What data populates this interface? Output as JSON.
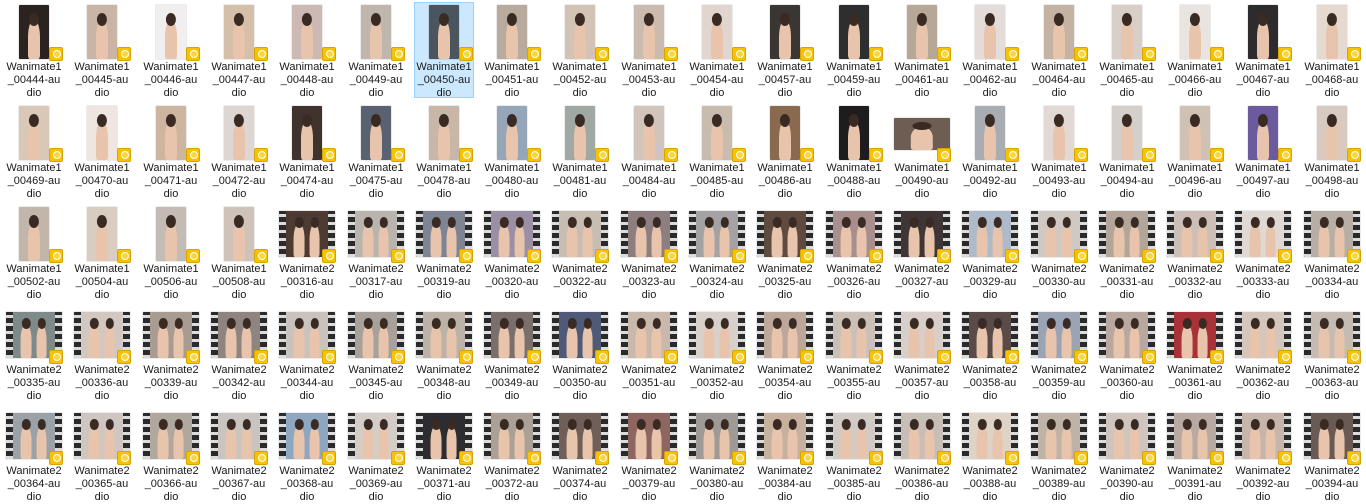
{
  "files": [
    {
      "name": "Wanimate1_00444-audio",
      "kind": "portrait",
      "bg": "#2b2320"
    },
    {
      "name": "Wanimate1_00445-audio",
      "kind": "portrait",
      "bg": "#c9b4a6"
    },
    {
      "name": "Wanimate1_00446-audio",
      "kind": "portrait",
      "bg": "#f0eeee"
    },
    {
      "name": "Wanimate1_00447-audio",
      "kind": "portrait",
      "bg": "#d6bfa8"
    },
    {
      "name": "Wanimate1_00448-audio",
      "kind": "portrait",
      "bg": "#cdb9b3"
    },
    {
      "name": "Wanimate1_00449-audio",
      "kind": "portrait",
      "bg": "#bfb6ad"
    },
    {
      "name": "Wanimate1_00450-audio",
      "kind": "portrait",
      "bg": "#4a5560",
      "selected": true
    },
    {
      "name": "Wanimate1_00451-audio",
      "kind": "portrait",
      "bg": "#b8aa9c"
    },
    {
      "name": "Wanimate1_00452-audio",
      "kind": "portrait",
      "bg": "#d2c3b4"
    },
    {
      "name": "Wanimate1_00453-audio",
      "kind": "portrait",
      "bg": "#cbbbae"
    },
    {
      "name": "Wanimate1_00454-audio",
      "kind": "portrait",
      "bg": "#e1d6cf"
    },
    {
      "name": "Wanimate1_00457-audio",
      "kind": "portrait",
      "bg": "#3a3634"
    },
    {
      "name": "Wanimate1_00459-audio",
      "kind": "portrait",
      "bg": "#2c2e30"
    },
    {
      "name": "Wanimate1_00461-audio",
      "kind": "portrait",
      "bg": "#b7a796"
    },
    {
      "name": "Wanimate1_00462-audio",
      "kind": "portrait",
      "bg": "#e4dcd9"
    },
    {
      "name": "Wanimate1_00464-audio",
      "kind": "portrait",
      "bg": "#c4b3a2"
    },
    {
      "name": "Wanimate1_00465-audio",
      "kind": "portrait",
      "bg": "#d8cfc8"
    },
    {
      "name": "Wanimate1_00466-audio",
      "kind": "portrait",
      "bg": "#e9e4df"
    },
    {
      "name": "Wanimate1_00467-audio",
      "kind": "portrait",
      "bg": "#2d2b2e"
    },
    {
      "name": "Wanimate1_00468-audio",
      "kind": "portrait",
      "bg": "#e6dad0"
    },
    {
      "name": "Wanimate1_00469-audio",
      "kind": "portrait",
      "bg": "#d9c7b8"
    },
    {
      "name": "Wanimate1_00470-audio",
      "kind": "portrait",
      "bg": "#efe6e2"
    },
    {
      "name": "Wanimate1_00471-audio",
      "kind": "portrait",
      "bg": "#cdb5a0"
    },
    {
      "name": "Wanimate1_00472-audio",
      "kind": "portrait",
      "bg": "#ddd6d2"
    },
    {
      "name": "Wanimate1_00474-audio",
      "kind": "portrait",
      "bg": "#40332d"
    },
    {
      "name": "Wanimate1_00475-audio",
      "kind": "portrait",
      "bg": "#5a6272"
    },
    {
      "name": "Wanimate1_00478-audio",
      "kind": "portrait",
      "bg": "#c8b7a8"
    },
    {
      "name": "Wanimate1_00480-audio",
      "kind": "portrait",
      "bg": "#95a6b8"
    },
    {
      "name": "Wanimate1_00481-audio",
      "kind": "portrait",
      "bg": "#a0a8a4"
    },
    {
      "name": "Wanimate1_00484-audio",
      "kind": "portrait",
      "bg": "#d1c5bb"
    },
    {
      "name": "Wanimate1_00485-audio",
      "kind": "portrait",
      "bg": "#c9bcae"
    },
    {
      "name": "Wanimate1_00486-audio",
      "kind": "portrait",
      "bg": "#8a6a4e"
    },
    {
      "name": "Wanimate1_00488-audio",
      "kind": "portrait",
      "bg": "#1e1c1c"
    },
    {
      "name": "Wanimate1_00490-audio",
      "kind": "landscape",
      "bg": "#6d5d52"
    },
    {
      "name": "Wanimate1_00492-audio",
      "kind": "portrait",
      "bg": "#a7adb3"
    },
    {
      "name": "Wanimate1_00493-audio",
      "kind": "portrait",
      "bg": "#e3d9d4"
    },
    {
      "name": "Wanimate1_00494-audio",
      "kind": "portrait",
      "bg": "#d5cfcc"
    },
    {
      "name": "Wanimate1_00496-audio",
      "kind": "portrait",
      "bg": "#cfc2b5"
    },
    {
      "name": "Wanimate1_00497-audio",
      "kind": "portrait",
      "bg": "#6b5a9e"
    },
    {
      "name": "Wanimate1_00498-audio",
      "kind": "portrait",
      "bg": "#d8cabf"
    },
    {
      "name": "Wanimate1_00502-audio",
      "kind": "portrait",
      "bg": "#c2b6ab"
    },
    {
      "name": "Wanimate1_00504-audio",
      "kind": "portrait",
      "bg": "#d9cdc2"
    },
    {
      "name": "Wanimate1_00506-audio",
      "kind": "portrait",
      "bg": "#c4bbb4"
    },
    {
      "name": "Wanimate1_00508-audio",
      "kind": "portrait",
      "bg": "#cfc2b8"
    },
    {
      "name": "Wanimate2_00316-audio",
      "kind": "video",
      "bg": "#4d3a30"
    },
    {
      "name": "Wanimate2_00317-audio",
      "kind": "video",
      "bg": "#b9b4ae"
    },
    {
      "name": "Wanimate2_00319-audio",
      "kind": "video",
      "bg": "#7e8494"
    },
    {
      "name": "Wanimate2_00320-audio",
      "kind": "video",
      "bg": "#9a8fa4"
    },
    {
      "name": "Wanimate2_00322-audio",
      "kind": "video",
      "bg": "#c8bdb3"
    },
    {
      "name": "Wanimate2_00323-audio",
      "kind": "video",
      "bg": "#8d7f80"
    },
    {
      "name": "Wanimate2_00324-audio",
      "kind": "video",
      "bg": "#a5a2a6"
    },
    {
      "name": "Wanimate2_00325-audio",
      "kind": "video",
      "bg": "#5f4a40"
    },
    {
      "name": "Wanimate2_00326-audio",
      "kind": "video",
      "bg": "#a88f8e"
    },
    {
      "name": "Wanimate2_00327-audio",
      "kind": "video",
      "bg": "#3f3436"
    },
    {
      "name": "Wanimate2_00329-audio",
      "kind": "video",
      "bg": "#aeb9c9"
    },
    {
      "name": "Wanimate2_00330-audio",
      "kind": "video",
      "bg": "#d0c8c2"
    },
    {
      "name": "Wanimate2_00331-audio",
      "kind": "video",
      "bg": "#b3a59a"
    },
    {
      "name": "Wanimate2_00332-audio",
      "kind": "video",
      "bg": "#cbbfb7"
    },
    {
      "name": "Wanimate2_00333-audio",
      "kind": "video",
      "bg": "#dfd8d3"
    },
    {
      "name": "Wanimate2_00334-audio",
      "kind": "video",
      "bg": "#b7aea6"
    },
    {
      "name": "Wanimate2_00335-audio",
      "kind": "video",
      "bg": "#7e8a8a"
    },
    {
      "name": "Wanimate2_00336-audio",
      "kind": "video",
      "bg": "#d2c8c1"
    },
    {
      "name": "Wanimate2_00339-audio",
      "kind": "video",
      "bg": "#a89c92"
    },
    {
      "name": "Wanimate2_00342-audio",
      "kind": "video",
      "bg": "#8f8580"
    },
    {
      "name": "Wanimate2_00344-audio",
      "kind": "video",
      "bg": "#c9c2bd"
    },
    {
      "name": "Wanimate2_00345-audio",
      "kind": "video",
      "bg": "#a8a09a"
    },
    {
      "name": "Wanimate2_00348-audio",
      "kind": "video",
      "bg": "#bdb2a8"
    },
    {
      "name": "Wanimate2_00349-audio",
      "kind": "video",
      "bg": "#7b6f6c"
    },
    {
      "name": "Wanimate2_00350-audio",
      "kind": "video",
      "bg": "#4f5a78"
    },
    {
      "name": "Wanimate2_00351-audio",
      "kind": "video",
      "bg": "#c9b8ac"
    },
    {
      "name": "Wanimate2_00352-audio",
      "kind": "video",
      "bg": "#d8d0cb"
    },
    {
      "name": "Wanimate2_00354-audio",
      "kind": "video",
      "bg": "#bca79a"
    },
    {
      "name": "Wanimate2_00355-audio",
      "kind": "video",
      "bg": "#cbc0b8"
    },
    {
      "name": "Wanimate2_00357-audio",
      "kind": "video",
      "bg": "#d8cfca"
    },
    {
      "name": "Wanimate2_00358-audio",
      "kind": "video",
      "bg": "#5a4a48"
    },
    {
      "name": "Wanimate2_00359-audio",
      "kind": "video",
      "bg": "#9aa4b5"
    },
    {
      "name": "Wanimate2_00360-audio",
      "kind": "video",
      "bg": "#b8a8a0"
    },
    {
      "name": "Wanimate2_00361-audio",
      "kind": "video",
      "bg": "#a83238"
    },
    {
      "name": "Wanimate2_00362-audio",
      "kind": "video",
      "bg": "#d4c5bd"
    },
    {
      "name": "Wanimate2_00363-audio",
      "kind": "video",
      "bg": "#c6bbb3"
    },
    {
      "name": "Wanimate2_00364-audio",
      "kind": "video",
      "bg": "#9aa2a8"
    },
    {
      "name": "Wanimate2_00365-audio",
      "kind": "video",
      "bg": "#cfc6c1"
    },
    {
      "name": "Wanimate2_00366-audio",
      "kind": "video",
      "bg": "#b0a79f"
    },
    {
      "name": "Wanimate2_00367-audio",
      "kind": "video",
      "bg": "#c9c4bf"
    },
    {
      "name": "Wanimate2_00368-audio",
      "kind": "video",
      "bg": "#8ea6c0"
    },
    {
      "name": "Wanimate2_00369-audio",
      "kind": "video",
      "bg": "#d4ccc6"
    },
    {
      "name": "Wanimate2_00371-audio",
      "kind": "video",
      "bg": "#2d2c30"
    },
    {
      "name": "Wanimate2_00372-audio",
      "kind": "video",
      "bg": "#aaa096"
    },
    {
      "name": "Wanimate2_00374-audio",
      "kind": "video",
      "bg": "#6f5f58"
    },
    {
      "name": "Wanimate2_00379-audio",
      "kind": "video",
      "bg": "#8e6660"
    },
    {
      "name": "Wanimate2_00380-audio",
      "kind": "video",
      "bg": "#a09a96"
    },
    {
      "name": "Wanimate2_00384-audio",
      "kind": "video",
      "bg": "#c6b09e"
    },
    {
      "name": "Wanimate2_00385-audio",
      "kind": "video",
      "bg": "#d2cac4"
    },
    {
      "name": "Wanimate2_00386-audio",
      "kind": "video",
      "bg": "#c7beb8"
    },
    {
      "name": "Wanimate2_00388-audio",
      "kind": "video",
      "bg": "#ddd3c6"
    },
    {
      "name": "Wanimate2_00389-audio",
      "kind": "video",
      "bg": "#bfb3a8"
    },
    {
      "name": "Wanimate2_00390-audio",
      "kind": "video",
      "bg": "#cfc5be"
    },
    {
      "name": "Wanimate2_00391-audio",
      "kind": "video",
      "bg": "#b8aaa2"
    },
    {
      "name": "Wanimate2_00392-audio",
      "kind": "video",
      "bg": "#c7b4ab"
    },
    {
      "name": "Wanimate2_00394-audio",
      "kind": "video",
      "bg": "#6a5a56"
    }
  ],
  "colors": {
    "selection_fill": "#cce8ff",
    "selection_border": "#99d1ff",
    "badge": "#f7c200"
  },
  "icons": {
    "media_badge": "media-player-badge-icon",
    "film_strip": "film-strip-icon"
  }
}
